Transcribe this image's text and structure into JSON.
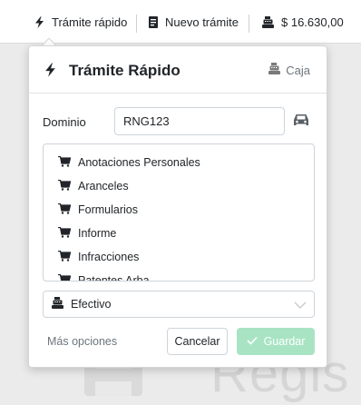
{
  "topbar": {
    "items": [
      {
        "label": "Trámite rápido",
        "icon": "bolt-icon"
      },
      {
        "label": "Nuevo trámite",
        "icon": "document-icon"
      },
      {
        "label": "$ 16.630,00",
        "icon": "cash-register-icon"
      }
    ]
  },
  "background": {
    "watermark_text": "Regis"
  },
  "panel": {
    "title": "Trámite Rápido",
    "title_icon": "bolt-icon",
    "caja_label": "Caja",
    "caja_icon": "cash-register-icon",
    "dominio_label": "Dominio",
    "dominio_value": "RNG123",
    "dominio_icon": "car-icon",
    "list_items": [
      "Anotaciones Personales",
      "Aranceles",
      "Formularios",
      "Informe",
      "Infracciones",
      "Patentes Arba"
    ],
    "list_item_icon": "cart-icon",
    "payment_method": "Efectivo",
    "payment_icon": "cash-register-icon",
    "more_options": "Más opciones",
    "cancel_label": "Cancelar",
    "save_label": "Guardar",
    "save_icon": "check-icon"
  },
  "colors": {
    "save_button": "#a8e4c3",
    "muted_text": "#6c757d",
    "border": "#ced4da"
  }
}
